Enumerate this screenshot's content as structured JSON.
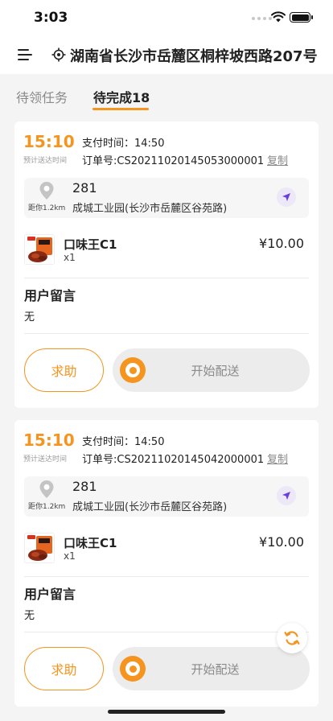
{
  "status_bar": {
    "time": "3:03"
  },
  "header": {
    "address": "湖南省长沙市岳麓区桐梓坡西路207号"
  },
  "tabs": [
    {
      "label": "待领任务",
      "active": false
    },
    {
      "label": "待完成18",
      "active": true
    }
  ],
  "orders": [
    {
      "delivery_time": "15:10",
      "delivery_time_label": "预计送达时间",
      "pay_time": "支付时间：14:50",
      "order_no": "订单号:CS20211020145053000001",
      "copy_label": "复制",
      "distance": "距你1.2km",
      "room": "281",
      "address": "成城工业园(长沙市岳麓区谷苑路)",
      "product_name": "口味王C1",
      "product_qty": "x1",
      "product_price": "¥10.00",
      "message_title": "用户留言",
      "message_text": "无",
      "help_label": "求助",
      "slider_label": "开始配送"
    },
    {
      "delivery_time": "15:10",
      "delivery_time_label": "预计送达时间",
      "pay_time": "支付时间：14:50",
      "order_no": "订单号:CS20211020145042000001",
      "copy_label": "复制",
      "distance": "距你1.2km",
      "room": "281",
      "address": "成城工业园(长沙市岳麓区谷苑路)",
      "product_name": "口味王C1",
      "product_qty": "x1",
      "product_price": "¥10.00",
      "message_title": "用户留言",
      "message_text": "无",
      "help_label": "求助",
      "slider_label": "开始配送"
    }
  ],
  "icons": {
    "menu": "menu-icon",
    "location": "location-target-icon",
    "pin": "map-pin-icon",
    "navigate": "navigation-arrow-icon",
    "refresh": "refresh-icon"
  },
  "colors": {
    "accent": "#f5941f",
    "nav_bg": "#ece8f7",
    "nav_arrow": "#6a3fd6"
  }
}
